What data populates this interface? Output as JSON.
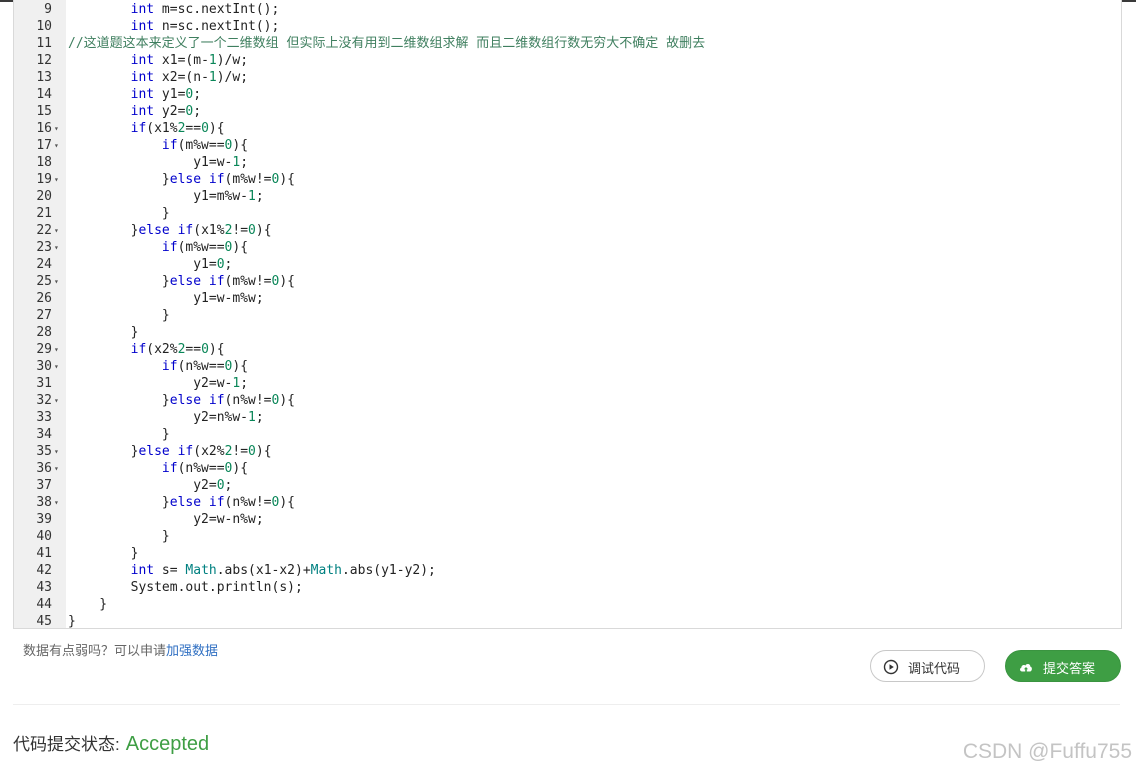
{
  "editor": {
    "lines": [
      {
        "no": "9",
        "fold": false,
        "text": "        int m=sc.nextInt();"
      },
      {
        "no": "10",
        "fold": false,
        "text": "        int n=sc.nextInt();"
      },
      {
        "no": "11",
        "fold": false,
        "comment": true,
        "text": "//这道题这本来定义了一个二维数组 但实际上没有用到二维数组求解 而且二维数组行数无穷大不确定 故删去"
      },
      {
        "no": "12",
        "fold": false,
        "text": "        int x1=(m-1)/w;"
      },
      {
        "no": "13",
        "fold": false,
        "text": "        int x2=(n-1)/w;"
      },
      {
        "no": "14",
        "fold": false,
        "text": "        int y1=0;"
      },
      {
        "no": "15",
        "fold": false,
        "text": "        int y2=0;"
      },
      {
        "no": "16",
        "fold": true,
        "text": "        if(x1%2==0){"
      },
      {
        "no": "17",
        "fold": true,
        "text": "            if(m%w==0){"
      },
      {
        "no": "18",
        "fold": false,
        "text": "                y1=w-1;"
      },
      {
        "no": "19",
        "fold": true,
        "text": "            }else if(m%w!=0){"
      },
      {
        "no": "20",
        "fold": false,
        "text": "                y1=m%w-1;"
      },
      {
        "no": "21",
        "fold": false,
        "text": "            }"
      },
      {
        "no": "22",
        "fold": true,
        "text": "        }else if(x1%2!=0){"
      },
      {
        "no": "23",
        "fold": true,
        "text": "            if(m%w==0){"
      },
      {
        "no": "24",
        "fold": false,
        "text": "                y1=0;"
      },
      {
        "no": "25",
        "fold": true,
        "text": "            }else if(m%w!=0){"
      },
      {
        "no": "26",
        "fold": false,
        "text": "                y1=w-m%w;"
      },
      {
        "no": "27",
        "fold": false,
        "text": "            }"
      },
      {
        "no": "28",
        "fold": false,
        "text": "        }"
      },
      {
        "no": "29",
        "fold": true,
        "text": "        if(x2%2==0){"
      },
      {
        "no": "30",
        "fold": true,
        "text": "            if(n%w==0){"
      },
      {
        "no": "31",
        "fold": false,
        "text": "                y2=w-1;"
      },
      {
        "no": "32",
        "fold": true,
        "text": "            }else if(n%w!=0){"
      },
      {
        "no": "33",
        "fold": false,
        "text": "                y2=n%w-1;"
      },
      {
        "no": "34",
        "fold": false,
        "text": "            }"
      },
      {
        "no": "35",
        "fold": true,
        "text": "        }else if(x2%2!=0){"
      },
      {
        "no": "36",
        "fold": true,
        "text": "            if(n%w==0){"
      },
      {
        "no": "37",
        "fold": false,
        "text": "                y2=0;"
      },
      {
        "no": "38",
        "fold": true,
        "text": "            }else if(n%w!=0){"
      },
      {
        "no": "39",
        "fold": false,
        "text": "                y2=w-n%w;"
      },
      {
        "no": "40",
        "fold": false,
        "text": "            }"
      },
      {
        "no": "41",
        "fold": false,
        "text": "        }"
      },
      {
        "no": "42",
        "fold": false,
        "text": "        int s= Math.abs(x1-x2)+Math.abs(y1-y2);"
      },
      {
        "no": "43",
        "fold": false,
        "text": "        System.out.println(s);"
      },
      {
        "no": "44",
        "fold": false,
        "text": "    }"
      },
      {
        "no": "45",
        "fold": false,
        "text": "}"
      }
    ]
  },
  "hint": {
    "text": "数据有点弱吗？可以申请",
    "link": "加强数据"
  },
  "buttons": {
    "debug": "调试代码",
    "submit": "提交答案"
  },
  "status": {
    "label": "代码提交状态:",
    "value": "Accepted"
  },
  "watermark": "CSDN @Fuffu755",
  "colors": {
    "keyword": "#0000cc",
    "number": "#098658",
    "comment": "#3f7f5f",
    "accent_green": "#3e9e44",
    "link": "#2f6fc2"
  }
}
